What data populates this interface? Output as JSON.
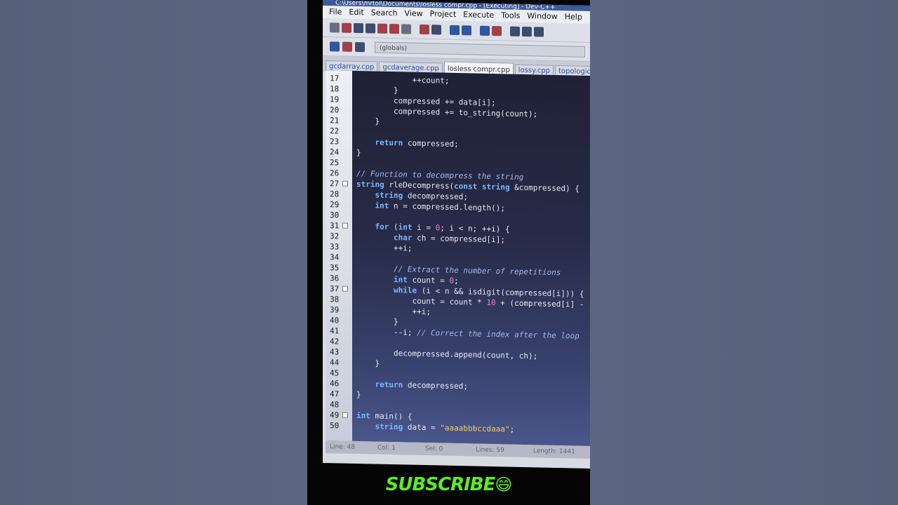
{
  "window": {
    "title": "C:\\Users\\mrtol\\Documents\\losless compr.cpp - [Executing] - Dev-C++"
  },
  "menu": [
    "File",
    "Edit",
    "Search",
    "View",
    "Project",
    "Execute",
    "Tools",
    "Window",
    "Help"
  ],
  "toolbar": {
    "scope_dropdown": "(globals)"
  },
  "tabs": [
    "gcdarray.cpp",
    "gcdaverage.cpp",
    "losless compr.cpp",
    "lossy.cpp",
    "topological.cpp"
  ],
  "active_tab_index": 2,
  "code_lines": [
    {
      "n": "17",
      "text": "            ++count;"
    },
    {
      "n": "18",
      "text": "        }"
    },
    {
      "n": "19",
      "text": "        compressed += data[i];"
    },
    {
      "n": "20",
      "text": "        compressed += to_string(count);"
    },
    {
      "n": "21",
      "text": "    }"
    },
    {
      "n": "22",
      "text": ""
    },
    {
      "n": "23",
      "text": "    return compressed;"
    },
    {
      "n": "24",
      "text": "}"
    },
    {
      "n": "25",
      "text": ""
    },
    {
      "n": "26",
      "text": "// Function to decompress the string"
    },
    {
      "n": "27",
      "text": "string rleDecompress(const string &compressed) {"
    },
    {
      "n": "28",
      "text": "    string decompressed;"
    },
    {
      "n": "29",
      "text": "    int n = compressed.length();"
    },
    {
      "n": "30",
      "text": ""
    },
    {
      "n": "31",
      "text": "    for (int i = 0; i < n; ++i) {"
    },
    {
      "n": "32",
      "text": "        char ch = compressed[i];"
    },
    {
      "n": "33",
      "text": "        ++i;"
    },
    {
      "n": "34",
      "text": ""
    },
    {
      "n": "35",
      "text": "        // Extract the number of repetitions"
    },
    {
      "n": "36",
      "text": "        int count = 0;"
    },
    {
      "n": "37",
      "text": "        while (i < n && isdigit(compressed[i])) {"
    },
    {
      "n": "38",
      "text": "            count = count * 10 + (compressed[i] -"
    },
    {
      "n": "39",
      "text": "            ++i;"
    },
    {
      "n": "40",
      "text": "        }"
    },
    {
      "n": "41",
      "text": "        --i; // Correct the index after the loop"
    },
    {
      "n": "42",
      "text": ""
    },
    {
      "n": "43",
      "text": "        decompressed.append(count, ch);"
    },
    {
      "n": "44",
      "text": "    }"
    },
    {
      "n": "45",
      "text": ""
    },
    {
      "n": "46",
      "text": "    return decompressed;"
    },
    {
      "n": "47",
      "text": "}"
    },
    {
      "n": "48",
      "text": ""
    },
    {
      "n": "49",
      "text": "int main() {"
    },
    {
      "n": "50",
      "text": "    string data = \"aaaabbbccdaaa\";"
    }
  ],
  "folded_lines": [
    "27",
    "31",
    "37",
    "49"
  ],
  "status": {
    "line": "Line: 48",
    "col": "Col: 1",
    "sel": "Sel: 0",
    "lines": "Lines: 59",
    "length": "Length: 1441"
  },
  "overlay": {
    "subscribe": "SUBSCRIBE",
    "emoji": "😄"
  }
}
